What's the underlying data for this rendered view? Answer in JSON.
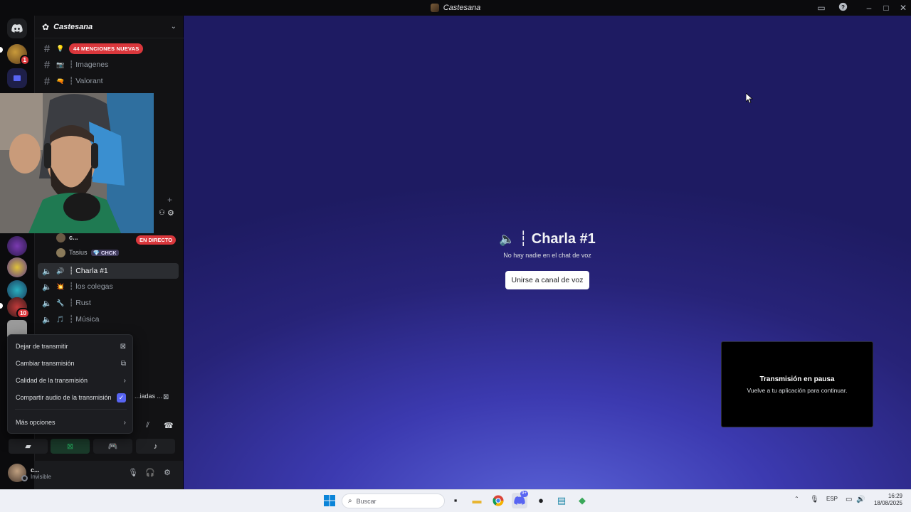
{
  "window": {
    "title": "Castesana"
  },
  "rail": {
    "badges": [
      "1",
      "10"
    ]
  },
  "sidebar": {
    "server_name": "Castesana",
    "text_channels": [
      {
        "emoji": "💡",
        "label": "",
        "badge": "44 MENCIONES NUEVAS"
      },
      {
        "emoji": "📷",
        "label": "┆ Imagenes"
      },
      {
        "emoji": "🔫",
        "label": "┆ Valorant"
      }
    ],
    "live_badge": "EN DIRECTO",
    "voice_users": [
      {
        "name": "c...",
        "tag": ""
      },
      {
        "name": "Tasius",
        "tag": "CHCK"
      }
    ],
    "voice_channels": [
      {
        "emoji": "🔊",
        "label": "┆ Charla #1",
        "active": true
      },
      {
        "emoji": "💥",
        "label": "┆ los colegas"
      },
      {
        "emoji": "🔧",
        "label": "┆ Rust"
      },
      {
        "emoji": "🎵",
        "label": "┆ Música"
      }
    ],
    "stream_status": "...iadas ..."
  },
  "context_menu": {
    "items": [
      {
        "label": "Dejar de transmitir",
        "icon": "stop-stream-icon"
      },
      {
        "label": "Cambiar transmisión",
        "icon": "change-stream-icon"
      },
      {
        "label": "Calidad de la transmisión",
        "icon": "chevron-right-icon"
      },
      {
        "label": "Compartir audio de la transmisión",
        "icon": "checkbox-checked-icon"
      },
      {
        "label": "Más opciones",
        "icon": "chevron-right-icon"
      }
    ]
  },
  "user_panel": {
    "username": "c...",
    "status": "Invisible"
  },
  "main": {
    "channel_title": "┆ Charla #1",
    "empty_text": "No hay nadie en el chat de voz",
    "join_button": "Unirse a canal de voz",
    "paused_title": "Transmisión en pausa",
    "paused_subtitle": "Vuelve a tu aplicación para continuar."
  },
  "taskbar": {
    "search_placeholder": "Buscar",
    "discord_badge": "9+",
    "language": "ESP",
    "time": "16:29",
    "date": "18/08/2025"
  },
  "colors": {
    "accent": "#5865f2",
    "danger": "#da373c",
    "online": "#23a55a"
  }
}
